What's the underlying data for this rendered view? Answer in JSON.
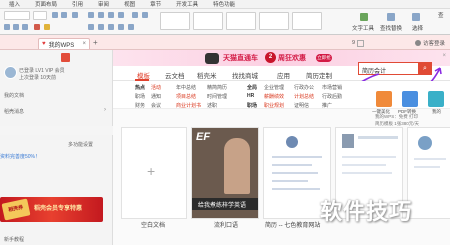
{
  "menubar": {
    "items": [
      "插入",
      "页面布局",
      "引用",
      "审阅",
      "视图",
      "章节",
      "开发工具",
      "特色功能"
    ]
  },
  "ribbon": {
    "right_labels": [
      "文字工具",
      "查找替换",
      "选择"
    ],
    "right_prefix": "查"
  },
  "tabbar": {
    "tab_label": "我的WPS",
    "add_label": "+",
    "right_items": [
      "9",
      "我的登录",
      "访客登录"
    ]
  },
  "left_panel": {
    "username": "已登录 LV1 VIP 会员",
    "subtitle": "上次登录 10天前",
    "row1": "我的文档",
    "row2": "稻壳消息",
    "progress_text": "资料完善度50%！",
    "more_label": "多功能设置",
    "promo_badge": "稻壳券",
    "promo_text": "稻壳会员专享特惠",
    "bottom_text": "新手教程"
  },
  "ad": {
    "text1": "天猫直通车",
    "badge": "2",
    "text2": "周狂欢惠",
    "button": "立即抢"
  },
  "nav": {
    "items": [
      "模板",
      "云文档",
      "稻壳米",
      "找找商城",
      "应用",
      "简历定制"
    ],
    "search_value": "简历会计",
    "search_icon": "search-icon"
  },
  "categories": {
    "col1": [
      "热点",
      "职场",
      "财务"
    ],
    "col2": [
      "活动",
      "通知",
      "会议"
    ],
    "col3": [
      "年中总结",
      "项目总结",
      "商业计划书"
    ],
    "col4": [
      "精简简历",
      "时间管理",
      "述职"
    ],
    "col5": [
      "全局",
      "HR",
      "职场"
    ],
    "col6": [
      "企业管理",
      "薪酬绩效",
      "职业规划"
    ],
    "col7": [
      "行政办公",
      "计划总结",
      "证明信"
    ],
    "col8": [
      "市场营销",
      "行政后勤",
      "推广"
    ]
  },
  "side": {
    "btn1_label": "一键美化",
    "btn2_label": "PDF转换",
    "btn3_label": "我的",
    "caption1": "我的WPS：免费 打印",
    "caption2": "简历模板 1张380元/天"
  },
  "cards": {
    "labels": [
      "空白文档",
      "流利口语",
      "简历 -- 七色教育网站",
      ""
    ],
    "card2_text": "给我煮练梓学英语",
    "card2_badge": "EF"
  },
  "watermark": "软件技巧"
}
